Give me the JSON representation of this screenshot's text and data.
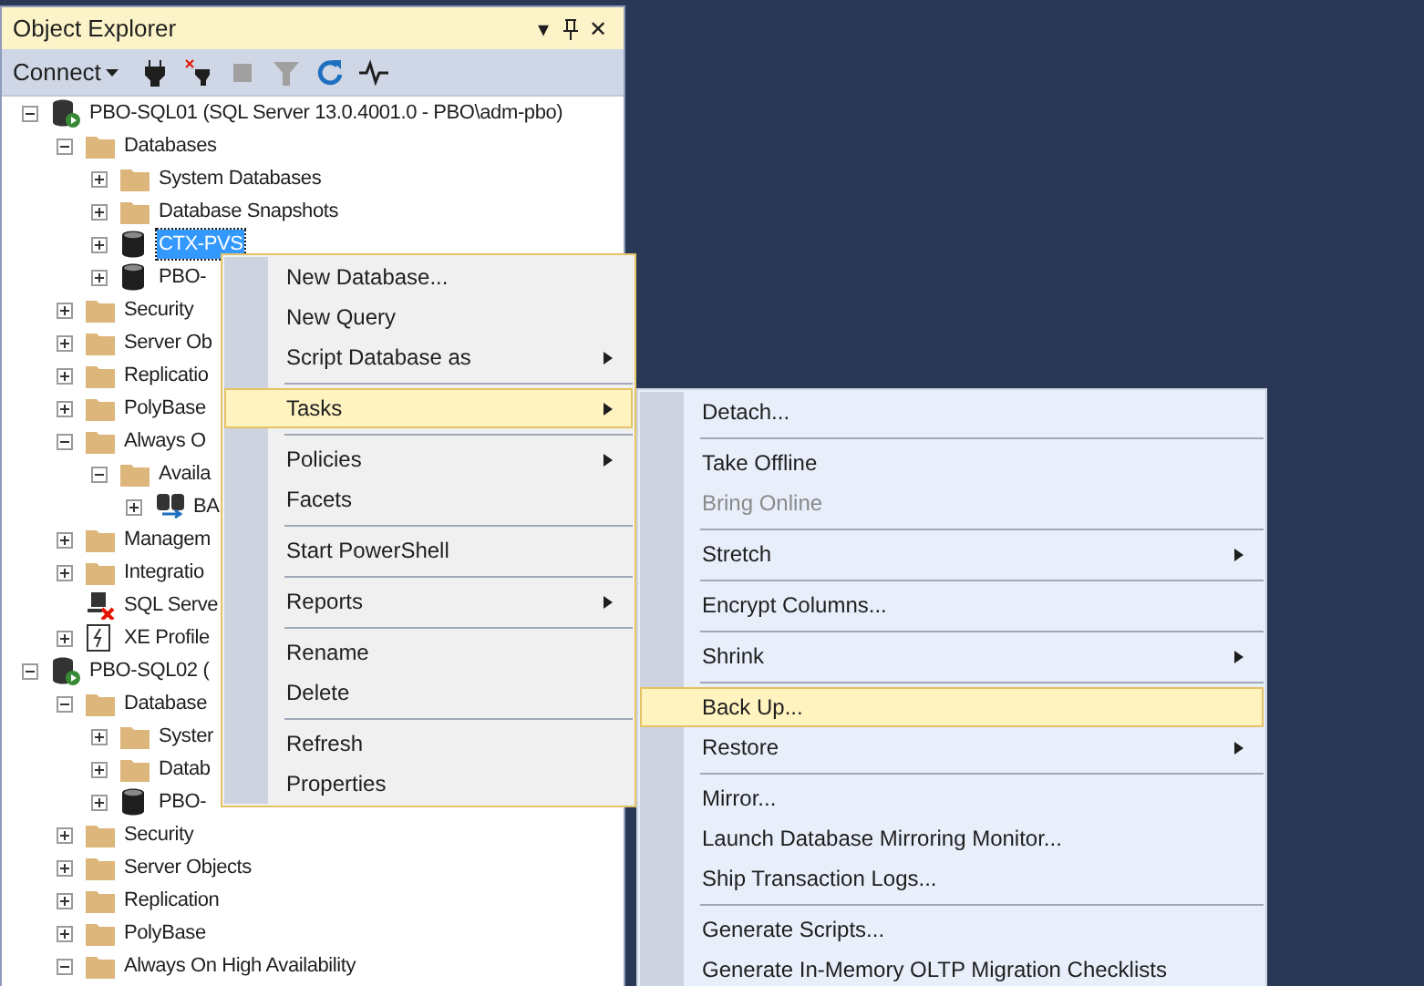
{
  "panel": {
    "title": "Object Explorer",
    "title_buttons": [
      "▾",
      "✕"
    ]
  },
  "toolbar": {
    "connect": "Connect",
    "buttons": [
      {
        "kind": "connect",
        "disabled": false
      },
      {
        "kind": "disconnect",
        "disabled": false
      },
      {
        "kind": "stop",
        "disabled": true
      },
      {
        "kind": "filter",
        "disabled": true
      },
      {
        "kind": "refresh",
        "disabled": false
      },
      {
        "kind": "activity",
        "disabled": false
      }
    ]
  },
  "tree": [
    {
      "label": "PBO-SQL01 (SQL Server 13.0.4001.0 - PBO\\adm-pbo)",
      "kind": "server",
      "expanded": true,
      "selected": false,
      "children": [
        {
          "label": "Databases",
          "kind": "folder",
          "expanded": true,
          "selected": false,
          "children": [
            {
              "label": "System Databases",
              "kind": "folder",
              "expanded": false,
              "selected": false
            },
            {
              "label": "Database Snapshots",
              "kind": "folder",
              "expanded": false,
              "selected": false
            },
            {
              "label": "CTX-PVS",
              "kind": "database",
              "expanded": false,
              "selected": true
            },
            {
              "label": "PBO-",
              "kind": "database",
              "expanded": false,
              "selected": false
            }
          ]
        },
        {
          "label": "Security",
          "kind": "folder",
          "expanded": false,
          "selected": false
        },
        {
          "label": "Server Ob",
          "kind": "folder",
          "expanded": false,
          "selected": false
        },
        {
          "label": "Replicatio",
          "kind": "folder",
          "expanded": false,
          "selected": false
        },
        {
          "label": "PolyBase",
          "kind": "folder",
          "expanded": false,
          "selected": false
        },
        {
          "label": "Always O",
          "kind": "folder",
          "expanded": true,
          "selected": false,
          "children": [
            {
              "label": "Availa",
              "kind": "folder",
              "expanded": true,
              "selected": false,
              "children": [
                {
                  "label": "BA",
                  "kind": "group",
                  "expanded": false,
                  "selected": false
                }
              ]
            }
          ]
        },
        {
          "label": "Managem",
          "kind": "folder",
          "expanded": false,
          "selected": false
        },
        {
          "label": "Integratio",
          "kind": "folder",
          "expanded": false,
          "selected": false
        },
        {
          "label": "SQL Serve",
          "kind": "agent",
          "selected": false
        },
        {
          "label": "XE Profile",
          "kind": "profiler",
          "expanded": false,
          "selected": false
        }
      ]
    },
    {
      "label": "PBO-SQL02 (",
      "kind": "server",
      "expanded": true,
      "selected": false,
      "children": [
        {
          "label": "Database",
          "kind": "folder",
          "expanded": true,
          "selected": false,
          "children": [
            {
              "label": "Syster",
              "kind": "folder",
              "expanded": false,
              "selected": false
            },
            {
              "label": "Datab",
              "kind": "folder",
              "expanded": false,
              "selected": false
            },
            {
              "label": "PBO-",
              "kind": "database",
              "expanded": false,
              "selected": false
            }
          ]
        },
        {
          "label": "Security",
          "kind": "folder",
          "expanded": false,
          "selected": false
        },
        {
          "label": "Server Objects",
          "kind": "folder",
          "expanded": false,
          "selected": false
        },
        {
          "label": "Replication",
          "kind": "folder",
          "expanded": false,
          "selected": false
        },
        {
          "label": "PolyBase",
          "kind": "folder",
          "expanded": false,
          "selected": false
        },
        {
          "label": "Always On High Availability",
          "kind": "folder",
          "expanded": true,
          "selected": false
        }
      ]
    }
  ],
  "context_menu": [
    {
      "kind": "item",
      "label": "New Database...",
      "submenu": false,
      "selected": false
    },
    {
      "kind": "item",
      "label": "New Query",
      "submenu": false,
      "selected": false
    },
    {
      "kind": "item",
      "label": "Script Database as",
      "submenu": true,
      "selected": false
    },
    {
      "kind": "separator"
    },
    {
      "kind": "item",
      "label": "Tasks",
      "submenu": true,
      "selected": true
    },
    {
      "kind": "separator"
    },
    {
      "kind": "item",
      "label": "Policies",
      "submenu": true,
      "selected": false
    },
    {
      "kind": "item",
      "label": "Facets",
      "submenu": false,
      "selected": false
    },
    {
      "kind": "separator"
    },
    {
      "kind": "item",
      "label": "Start PowerShell",
      "submenu": false,
      "selected": false
    },
    {
      "kind": "separator"
    },
    {
      "kind": "item",
      "label": "Reports",
      "submenu": true,
      "selected": false
    },
    {
      "kind": "separator"
    },
    {
      "kind": "item",
      "label": "Rename",
      "submenu": false,
      "selected": false
    },
    {
      "kind": "item",
      "label": "Delete",
      "submenu": false,
      "selected": false
    },
    {
      "kind": "separator"
    },
    {
      "kind": "item",
      "label": "Refresh",
      "submenu": false,
      "selected": false
    },
    {
      "kind": "item",
      "label": "Properties",
      "submenu": false,
      "selected": false
    }
  ],
  "tasks_menu": [
    {
      "kind": "item",
      "label": "Detach...",
      "submenu": false,
      "selected": false,
      "disabled": false
    },
    {
      "kind": "separator"
    },
    {
      "kind": "item",
      "label": "Take Offline",
      "submenu": false,
      "selected": false,
      "disabled": false
    },
    {
      "kind": "item",
      "label": "Bring Online",
      "submenu": false,
      "selected": false,
      "disabled": true
    },
    {
      "kind": "separator"
    },
    {
      "kind": "item",
      "label": "Stretch",
      "submenu": true,
      "selected": false,
      "disabled": false
    },
    {
      "kind": "separator"
    },
    {
      "kind": "item",
      "label": "Encrypt Columns...",
      "submenu": false,
      "selected": false,
      "disabled": false
    },
    {
      "kind": "separator"
    },
    {
      "kind": "item",
      "label": "Shrink",
      "submenu": true,
      "selected": false,
      "disabled": false
    },
    {
      "kind": "separator"
    },
    {
      "kind": "item",
      "label": "Back Up...",
      "submenu": false,
      "selected": true,
      "disabled": false
    },
    {
      "kind": "item",
      "label": "Restore",
      "submenu": true,
      "selected": false,
      "disabled": false
    },
    {
      "kind": "separator"
    },
    {
      "kind": "item",
      "label": "Mirror...",
      "submenu": false,
      "selected": false,
      "disabled": false
    },
    {
      "kind": "item",
      "label": "Launch Database Mirroring Monitor...",
      "submenu": false,
      "selected": false,
      "disabled": false
    },
    {
      "kind": "item",
      "label": "Ship Transaction Logs...",
      "submenu": false,
      "selected": false,
      "disabled": false
    },
    {
      "kind": "separator"
    },
    {
      "kind": "item",
      "label": "Generate Scripts...",
      "submenu": false,
      "selected": false,
      "disabled": false
    },
    {
      "kind": "item",
      "label": "Generate In-Memory OLTP Migration Checklists",
      "submenu": false,
      "selected": false,
      "disabled": false
    }
  ]
}
